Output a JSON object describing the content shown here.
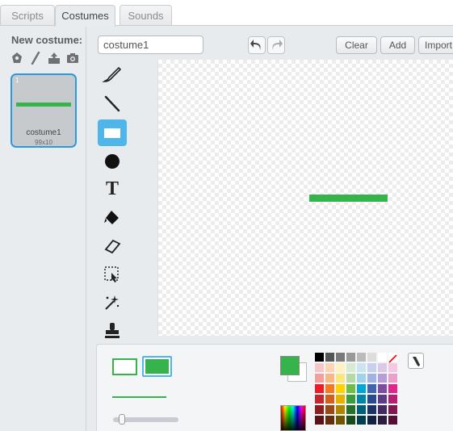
{
  "tabs": [
    {
      "label": "Scripts"
    },
    {
      "label": "Costumes"
    },
    {
      "label": "Sounds"
    }
  ],
  "sidebar": {
    "new_costume_label": "New costume:",
    "new_costume_icons": [
      "choose-from-library-icon",
      "paint-brush-icon",
      "upload-icon",
      "camera-icon"
    ],
    "costume": {
      "number": "1",
      "name": "costume1",
      "size": "99x10"
    }
  },
  "editor": {
    "costume_name_value": "costume1",
    "buttons": {
      "clear": "Clear",
      "add": "Add",
      "import": "Import"
    },
    "tools": [
      "brush-tool-icon",
      "line-tool-icon",
      "rectangle-tool-icon",
      "ellipse-tool-icon",
      "text-tool-icon",
      "fill-bucket-tool-icon",
      "eraser-tool-icon",
      "select-tool-icon",
      "select-remove-background-icon",
      "stamp-tool-icon"
    ],
    "selected_tool": "rectangle-tool-icon",
    "text_tool_glyph": "T"
  },
  "colors": {
    "selected": "#36b34a",
    "accent": "#4eb6e8",
    "palette": [
      [
        "#000000",
        "#555555",
        "#7a7a7a",
        "#999999",
        "#bbbbbb",
        "#dddddd",
        "#ffffff",
        "#ff0000"
      ],
      [
        "#f7c6c7",
        "#fbd4b4",
        "#fdf3c2",
        "#d9ead3",
        "#c9e6f0",
        "#c7d1ee",
        "#d9cbe8",
        "#f4c8e0"
      ],
      [
        "#f59ea0",
        "#f9b985",
        "#fbe77e",
        "#b5d9a7",
        "#a0d3e8",
        "#a1b3e2",
        "#b89ed6",
        "#ec9fc9"
      ],
      [
        "#ee1c25",
        "#f47920",
        "#ffd200",
        "#6cbe45",
        "#00a6d6",
        "#3f64b1",
        "#7d4ea0",
        "#e0268c"
      ],
      [
        "#c1272d",
        "#d1601b",
        "#e5b200",
        "#3c9a3f",
        "#0085a8",
        "#2b4a8e",
        "#5e3b86",
        "#b51f72"
      ],
      [
        "#8c1d20",
        "#9a4915",
        "#b08600",
        "#26702b",
        "#005f79",
        "#1d3366",
        "#432a60",
        "#82174f"
      ],
      [
        "#5b1215",
        "#642f0e",
        "#715600",
        "#184a1c",
        "#003e4f",
        "#132243",
        "#2c1c3f",
        "#540f33"
      ]
    ]
  }
}
